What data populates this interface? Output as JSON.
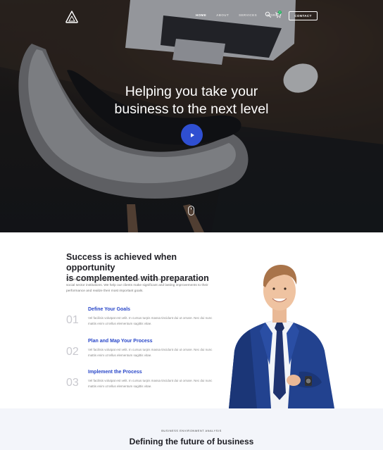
{
  "nav": {
    "links": [
      "HOME",
      "ABOUT",
      "SERVICES",
      "WORK"
    ],
    "active": "HOME",
    "cart_count": "0",
    "contact_label": "CONTACT"
  },
  "hero": {
    "title_line1": "Helping you take your",
    "title_line2": "business to the next level",
    "play_icon": "play-icon",
    "scroll_icon": "mouse-scroll-icon"
  },
  "about": {
    "heading_line1": "Success is achieved when opportunity",
    "heading_line2": "is complemented with preparation",
    "intro": "We are a global management consulting firm that serves a broad mix of private, public and social sector institutions. We help our clients make significant and lasting improvements to their performance and realize their most important goals.",
    "steps": [
      {
        "num": "01",
        "title": "Define Your Goals",
        "text": "Vel facilisis volutpat est velit. In cursus turpis massa tincidunt dui ut ornare. Nec dui nunc mattis enim ut tellus elementum sagittis vitae."
      },
      {
        "num": "02",
        "title": "Plan and Map Your Process",
        "text": "Vel facilisis volutpat est velit. In cursus turpis massa tincidunt dui ut ornare. Nec dui nunc mattis enim ut tellus elementum sagittis vitae."
      },
      {
        "num": "03",
        "title": "Implement the Process",
        "text": "Vel facilisis volutpat est velit. In cursus turpis massa tincidunt dui ut ornare. Nec dui nunc mattis enim ut tellus elementum sagittis vitae."
      }
    ]
  },
  "analysis": {
    "overline": "BUSINESS ENVIRONMENT ANALYSIS",
    "title": "Defining the future of business"
  },
  "colors": {
    "accent": "#2f4fd1",
    "step_title": "#2947c9",
    "badge": "#22b35e"
  }
}
